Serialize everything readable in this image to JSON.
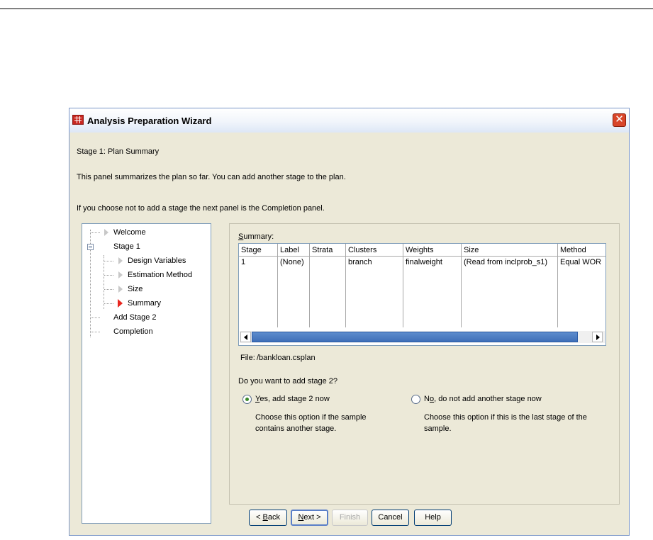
{
  "window": {
    "title": "Analysis Preparation Wizard",
    "close_glyph": "✕"
  },
  "header": {
    "stage_title": "Stage 1: Plan Summary",
    "description": "This panel summarizes the plan so far. You can add another stage to the plan.",
    "note": "If you choose not to add a stage the next panel is the Completion panel."
  },
  "tree": {
    "items": [
      {
        "label": "Welcome"
      },
      {
        "label": "Stage 1"
      },
      {
        "label": "Design Variables"
      },
      {
        "label": "Estimation Method"
      },
      {
        "label": "Size"
      },
      {
        "label": "Summary"
      },
      {
        "label": "Add Stage 2"
      },
      {
        "label": "Completion"
      }
    ]
  },
  "summary": {
    "label_first": "S",
    "label_rest": "ummary:",
    "columns": [
      "Stage",
      "Label",
      "Strata",
      "Clusters",
      "Weights",
      "Size",
      "Method"
    ],
    "rows": [
      [
        "1",
        "(None)",
        "",
        "branch",
        "finalweight",
        "(Read from inclprob_s1)",
        "Equal WOR"
      ]
    ]
  },
  "file": {
    "label": "File:",
    "path": "/bankloan.csplan"
  },
  "question": "Do you want to add stage 2?",
  "options": {
    "yes": {
      "key": "Y",
      "rest": "es, add stage 2 now",
      "selected": true,
      "hint": [
        "Choose this option if the sample",
        "contains another stage."
      ]
    },
    "no": {
      "pre": "N",
      "key": "o",
      "rest": ", do not add another stage now",
      "selected": false,
      "hint": [
        "Choose this option if this is the last stage of the",
        "sample."
      ]
    }
  },
  "buttons": {
    "back": {
      "pre": "< ",
      "key": "B",
      "rest": "ack"
    },
    "next": {
      "key": "N",
      "rest": "ext >"
    },
    "finish": "Finish",
    "cancel": "Cancel",
    "help": "Help"
  },
  "colors": {
    "dialog_bg": "#ece9d8",
    "active_marker": "#e8261f",
    "scroll_thumb": "#3f6fb8",
    "close_button": "#d8462a"
  }
}
